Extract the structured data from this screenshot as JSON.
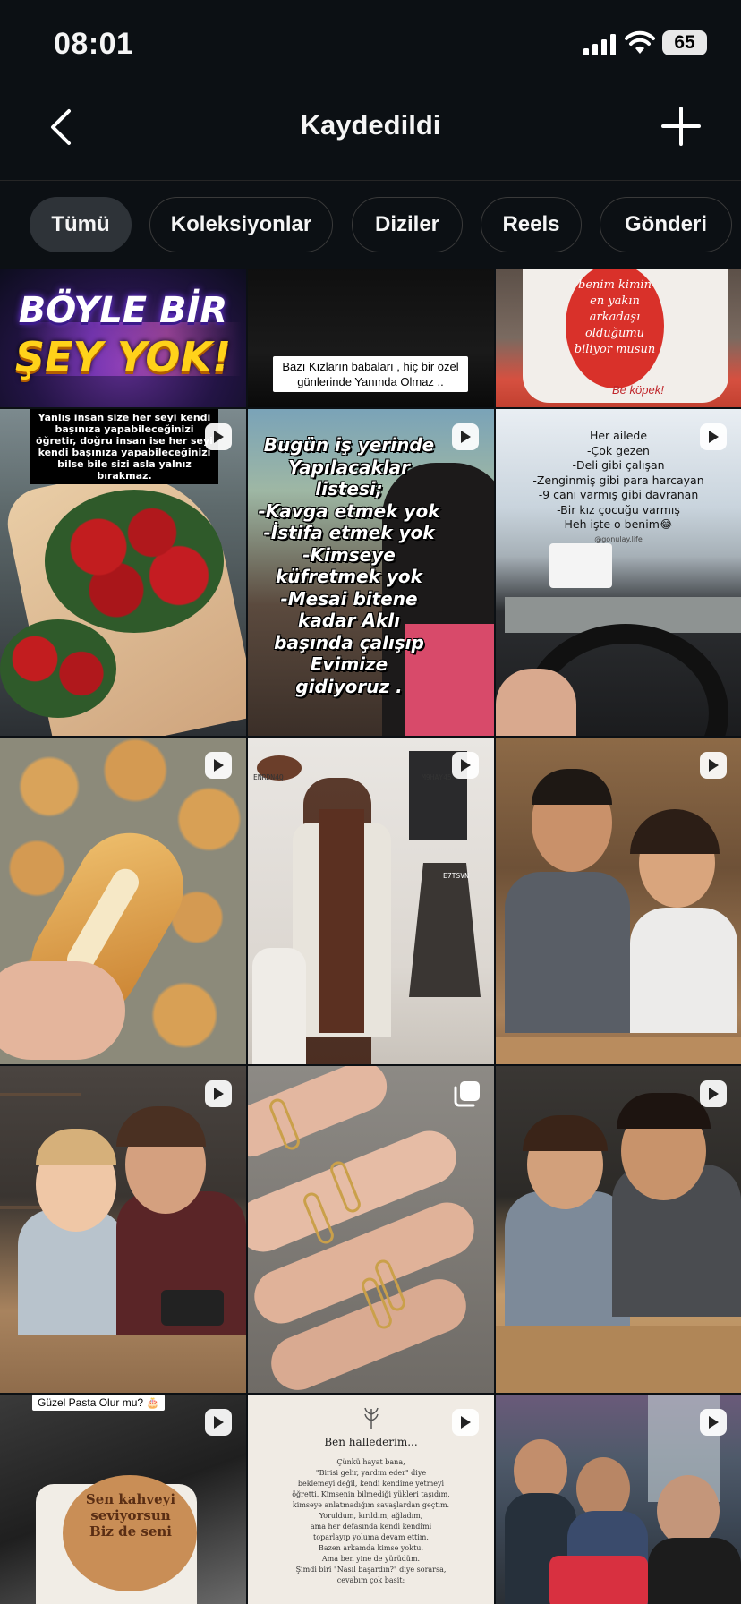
{
  "status_bar": {
    "time": "08:01",
    "battery": "65"
  },
  "header": {
    "title": "Kaydedildi"
  },
  "tabs": [
    "Tümü",
    "Koleksiyonlar",
    "Diziler",
    "Reels",
    "Gönderi"
  ],
  "posts": {
    "p1": {
      "line1": "BÖYLE BİR",
      "line2": "ŞEY YOK!"
    },
    "p2": {
      "caption": "Bazı Kızların babaları , hiç bir özel günlerinde Yanında Olmaz .."
    },
    "p3": {
      "mug_text": "benim kimin en yakın arkadaşı olduğumu biliyor musun",
      "bottom": "Be köpek!"
    },
    "p4": {
      "caption": "Yanlış insan size her seyi kendi başınıza yapabileceğinizi öğretir, doğru insan ise her seyi kendi başınıza yapabileceğinizi bilse bile sizi asla yalnız bırakmaz."
    },
    "p5": {
      "lines": [
        "Bugün iş yerinde",
        "Yapılacaklar",
        "listesi;",
        "-Kavga etmek yok",
        "-İstifa etmek yok",
        "-Kimseye",
        "küfretmek yok",
        "-Mesai bitene",
        "kadar Aklı",
        "başında çalışıp",
        "Evimize",
        "gidiyoruz ."
      ]
    },
    "p6": {
      "lines": [
        "Her ailede",
        "-Çok gezen",
        "-Deli gibi çalışan",
        "-Zenginmiş gibi para harcayan",
        "-9 canı varmış gibi davranan",
        "-Bir kız çocuğu varmış",
        "Heh işte o benim😂"
      ],
      "handle": "@gonulay.life"
    },
    "p8": {
      "code1": "ENRDN4Q",
      "code2": "M9HAY45",
      "code3": "E7TSVN"
    },
    "p13": {
      "caption": "Güzel Pasta Olur mu? 🎂",
      "cake": "Sen kahveyi seviyorsun Biz de seni"
    },
    "p14": {
      "heading": "Ben hallederim...",
      "lines": [
        "Çünkü hayat bana,",
        "\"Birisi gelir, yardım eder\" diye",
        "beklemeyi değil, kendi kendime yetmeyi",
        "öğretti. Kimsenin bilmediği yükleri taşıdım,",
        "kimseye anlatmadığım savaşlardan geçtim.",
        "Yoruldum, kırıldım, ağladım,",
        "ama her defasında kendi kendimi",
        "toparlayıp yoluma devam ettim.",
        "Bazen arkamda kimse yoktu.",
        "Ama ben yine de yürüdüm.",
        "Şimdi biri \"Nasıl başardın?\" diye sorarsa,",
        "cevabım çok basit:"
      ]
    }
  },
  "colors": {
    "background": "#0c1014",
    "chip_active": "#2e3338",
    "chip_border": "#3a3a3a"
  }
}
